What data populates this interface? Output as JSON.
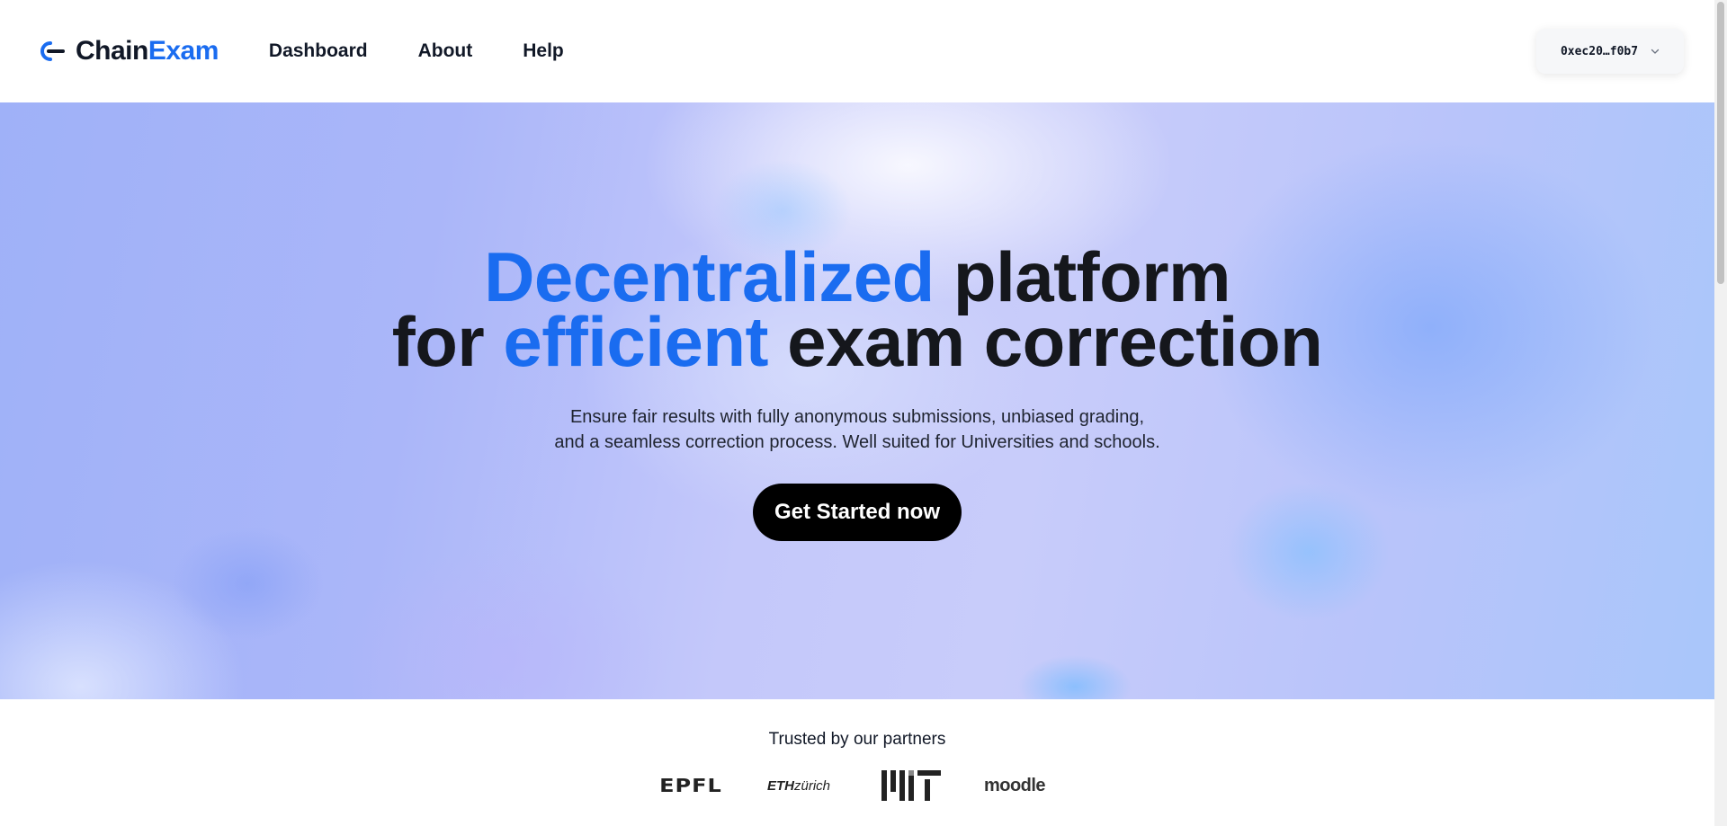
{
  "header": {
    "logo": {
      "part1": "Chain",
      "part2": "Exam",
      "icon": "chain-link-icon"
    },
    "nav": [
      {
        "label": "Dashboard"
      },
      {
        "label": "About"
      },
      {
        "label": "Help"
      }
    ],
    "wallet": {
      "address": "0xec20…f0b7",
      "icon": "chevron-down-icon"
    }
  },
  "hero": {
    "title_line1_accent": "Decentralized",
    "title_line1_rest": " platform",
    "title_line2_start": "for ",
    "title_line2_accent": "efficient",
    "title_line2_rest": " exam correction",
    "subtitle_line1": "Ensure fair results with fully anonymous submissions, unbiased grading,",
    "subtitle_line2": "and a seamless correction process. Well suited for Universities and schools.",
    "cta_label": "Get Started now"
  },
  "partners": {
    "title": "Trusted by our partners",
    "logos": {
      "epfl": "EPFL",
      "eth_bold": "ETH",
      "eth_rest": "zürich",
      "mit": "MIT",
      "moodle": "moodle"
    }
  },
  "colors": {
    "accent": "#1a6cf0",
    "text": "#15171c",
    "button": "#000000"
  }
}
